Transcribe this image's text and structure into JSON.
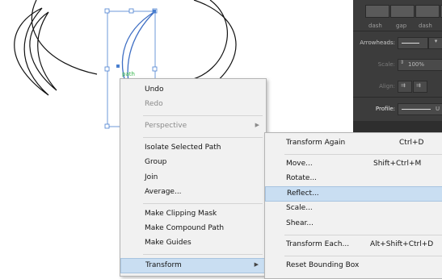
{
  "canvas": {
    "path_label": "path",
    "accent": "#4a7fd0",
    "label_color": "#33b54a"
  },
  "stroke_panel": {
    "dash_labels": [
      "dash",
      "gap",
      "dash"
    ],
    "arrowheads_label": "Arrowheads:",
    "scale_label": "Scale:",
    "scale_value": "100%",
    "align_label": "Align:",
    "profile_label": "Profile:",
    "profile_value_partial": "U"
  },
  "context_menu": {
    "items": [
      {
        "label": "Undo",
        "enabled": true
      },
      {
        "label": "Redo",
        "enabled": false
      },
      {
        "label": "Perspective",
        "enabled": false,
        "submenu": true
      },
      {
        "label": "Isolate Selected Path",
        "enabled": true
      },
      {
        "label": "Group",
        "enabled": true
      },
      {
        "label": "Join",
        "enabled": true
      },
      {
        "label": "Average...",
        "enabled": true
      },
      {
        "label": "Make Clipping Mask",
        "enabled": true
      },
      {
        "label": "Make Compound Path",
        "enabled": true
      },
      {
        "label": "Make Guides",
        "enabled": true
      },
      {
        "label": "Transform",
        "enabled": true,
        "submenu": true,
        "highlighted": true
      }
    ],
    "highlight_color": "#c9def2"
  },
  "transform_submenu": {
    "items": [
      {
        "label": "Transform Again",
        "shortcut": "Ctrl+D"
      },
      {
        "label": "Move...",
        "shortcut": "Shift+Ctrl+M"
      },
      {
        "label": "Rotate...",
        "shortcut": ""
      },
      {
        "label": "Reflect...",
        "shortcut": "",
        "highlighted": true
      },
      {
        "label": "Scale...",
        "shortcut": ""
      },
      {
        "label": "Shear...",
        "shortcut": ""
      },
      {
        "label": "Transform Each...",
        "shortcut": "Alt+Shift+Ctrl+D"
      },
      {
        "label": "Reset Bounding Box",
        "shortcut": ""
      }
    ]
  }
}
